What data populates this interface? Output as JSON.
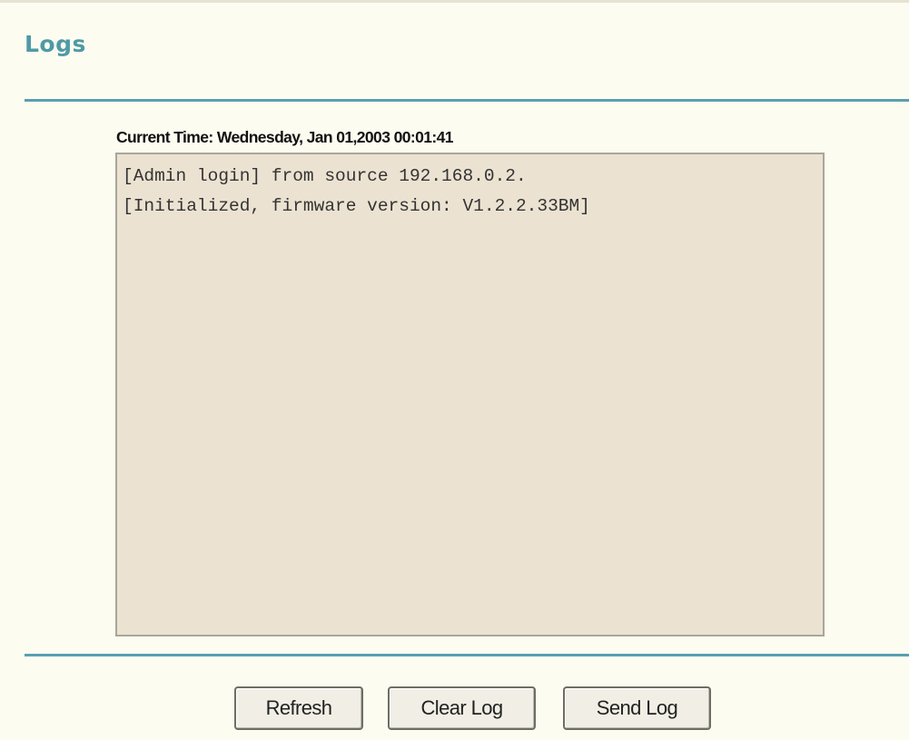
{
  "header": {
    "title": "Logs"
  },
  "logs": {
    "current_time_label": "Current Time:",
    "current_time_value": "Wednesday, Jan 01,2003 00:01:41",
    "content": "[Admin login] from source 192.168.0.2.\n[Initialized, firmware version: V1.2.2.33BM]\n\n"
  },
  "actions": {
    "refresh_label": "Refresh",
    "clear_label": "Clear Log",
    "send_label": "Send Log"
  },
  "colors": {
    "page_background": "#fdfcf1",
    "title_accent": "#4f9aa6",
    "divider": "#5b9fb0",
    "log_background": "#ebe2d1"
  }
}
